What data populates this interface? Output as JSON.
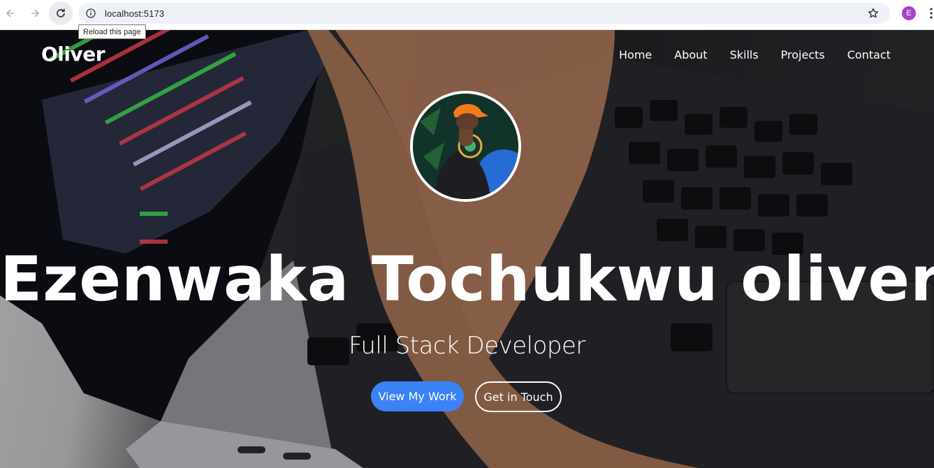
{
  "browser": {
    "url": "localhost:5173",
    "tooltip": "Reload this page",
    "profile_initial": "E",
    "profile_color": "#a442c8"
  },
  "site": {
    "logo": "Oliver",
    "nav": [
      "Home",
      "About",
      "Skills",
      "Projects",
      "Contact"
    ]
  },
  "hero": {
    "name": "Ezenwaka Tochukwu oliver",
    "subtitle": "Full Stack Developer",
    "primary_button": "View My Work",
    "secondary_button": "Get in Touch",
    "accent_color": "#3b82f6"
  },
  "icons": [
    "back-arrow-icon",
    "forward-arrow-icon",
    "reload-icon",
    "site-info-icon",
    "bookmark-star-icon",
    "menu-kebab-icon"
  ]
}
